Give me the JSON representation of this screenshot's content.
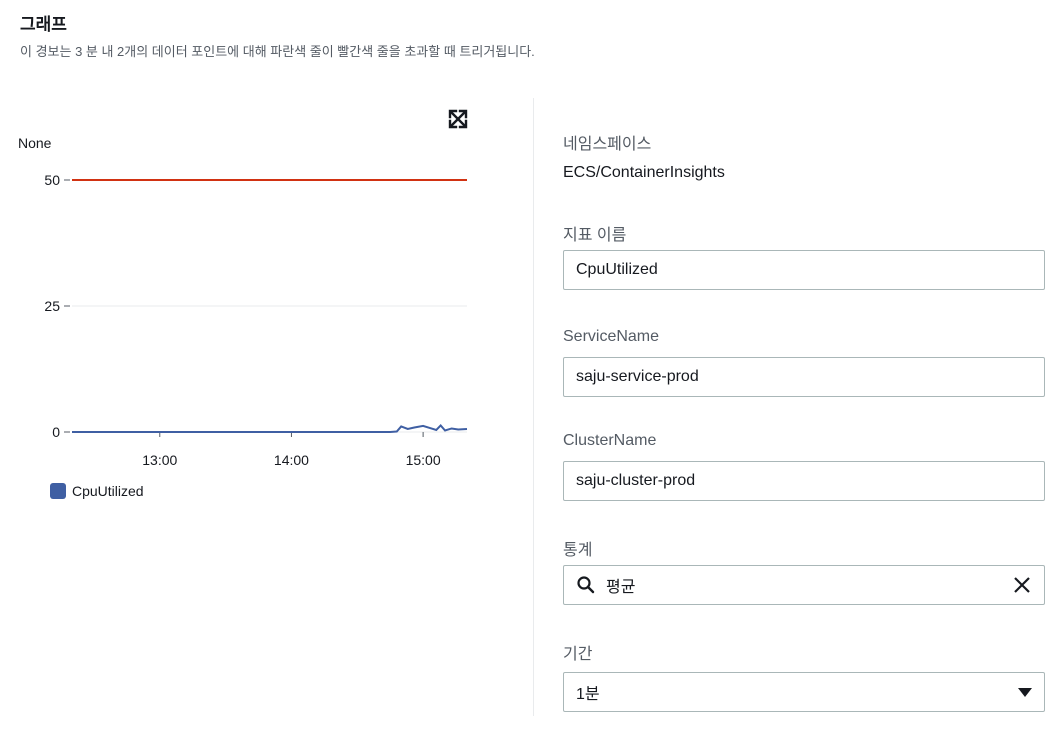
{
  "header": {
    "title": "그래프",
    "description": "이 경보는 3 분 내 2개의 데이터 포인트에 대해 파란색 줄이 빨간색 줄을 초과할 때 트리거됩니다."
  },
  "chart_data": {
    "type": "line",
    "ylabel": "None",
    "ylim": [
      0,
      50
    ],
    "yticks": [
      "50",
      "25",
      "0"
    ],
    "xticks": [
      "13:00",
      "14:00",
      "15:00"
    ],
    "threshold": {
      "value": 50,
      "color": "#d13212"
    },
    "series": [
      {
        "name": "CpuUtilized",
        "color": "#3f5fa3",
        "points": [
          [
            "12:20",
            0
          ],
          [
            "13:00",
            0
          ],
          [
            "14:00",
            0
          ],
          [
            "14:45",
            0
          ],
          [
            "14:48",
            0.1
          ],
          [
            "14:50",
            1.1
          ],
          [
            "14:53",
            0.6
          ],
          [
            "14:56",
            0.9
          ],
          [
            "15:00",
            1.2
          ],
          [
            "15:03",
            0.8
          ],
          [
            "15:06",
            0.4
          ],
          [
            "15:08",
            1.3
          ],
          [
            "15:10",
            0.3
          ],
          [
            "15:13",
            0.7
          ],
          [
            "15:16",
            0.5
          ],
          [
            "15:20",
            0.6
          ]
        ]
      }
    ],
    "legend": "bottom-left"
  },
  "panel": {
    "namespace_label": "네임스페이스",
    "namespace_value": "ECS/ContainerInsights",
    "metric_label": "지표 이름",
    "metric_value": "CpuUtilized",
    "service_label": "ServiceName",
    "service_value": "saju-service-prod",
    "cluster_label": "ClusterName",
    "cluster_value": "saju-cluster-prod",
    "stat_label": "통계",
    "stat_value": "평균",
    "period_label": "기간",
    "period_value": "1분"
  }
}
